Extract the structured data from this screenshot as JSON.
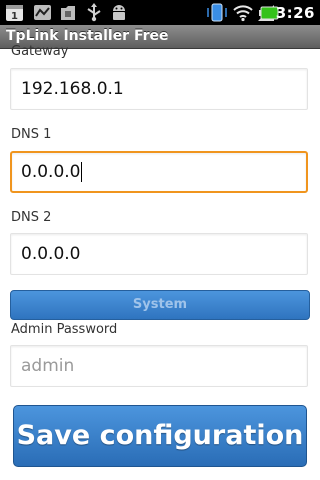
{
  "status_bar": {
    "time": "3:26",
    "icons": [
      "calendar-icon",
      "usb-debug-icon",
      "download-icon",
      "usb-icon",
      "android-icon",
      "vibrate-icon",
      "wifi-icon",
      "signal-icon",
      "battery-icon"
    ],
    "calendar_day": "1"
  },
  "app": {
    "title": "TpLink Installer Free"
  },
  "form": {
    "gateway": {
      "label": "Gateway",
      "value": "192.168.0.1"
    },
    "dns1": {
      "label": "DNS 1",
      "value": "0.0.0.0"
    },
    "dns2": {
      "label": "DNS 2",
      "value": "0.0.0.0"
    },
    "system_button": "System",
    "admin_password": {
      "label": "Admin Password",
      "placeholder": "admin"
    },
    "save_button": "Save configuration"
  },
  "colors": {
    "focus": "#f0951e",
    "button_blue": "#3a80cc",
    "battery_green": "#34c21a"
  }
}
